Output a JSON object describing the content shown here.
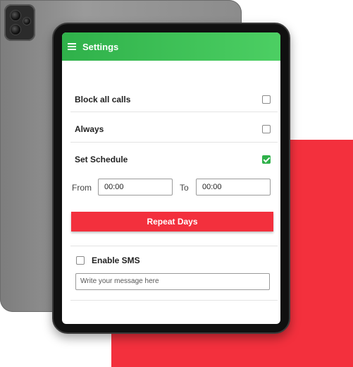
{
  "app": {
    "title": "Settings",
    "accent_color": "#2fb14a",
    "action_color": "#f3303d",
    "menu_icon": "menu-icon"
  },
  "settings": {
    "block_all_calls": {
      "label": "Block all calls",
      "checked": false
    },
    "always": {
      "label": "Always",
      "checked": false
    },
    "set_schedule": {
      "label": "Set Schedule",
      "checked": true
    }
  },
  "schedule": {
    "from_label": "From",
    "from_value": "00:00",
    "to_label": "To",
    "to_value": "00:00"
  },
  "repeat_button": {
    "label": "Repeat Days"
  },
  "sms": {
    "enable_label": "Enable SMS",
    "checked": false,
    "message_placeholder": "Write your message here"
  }
}
